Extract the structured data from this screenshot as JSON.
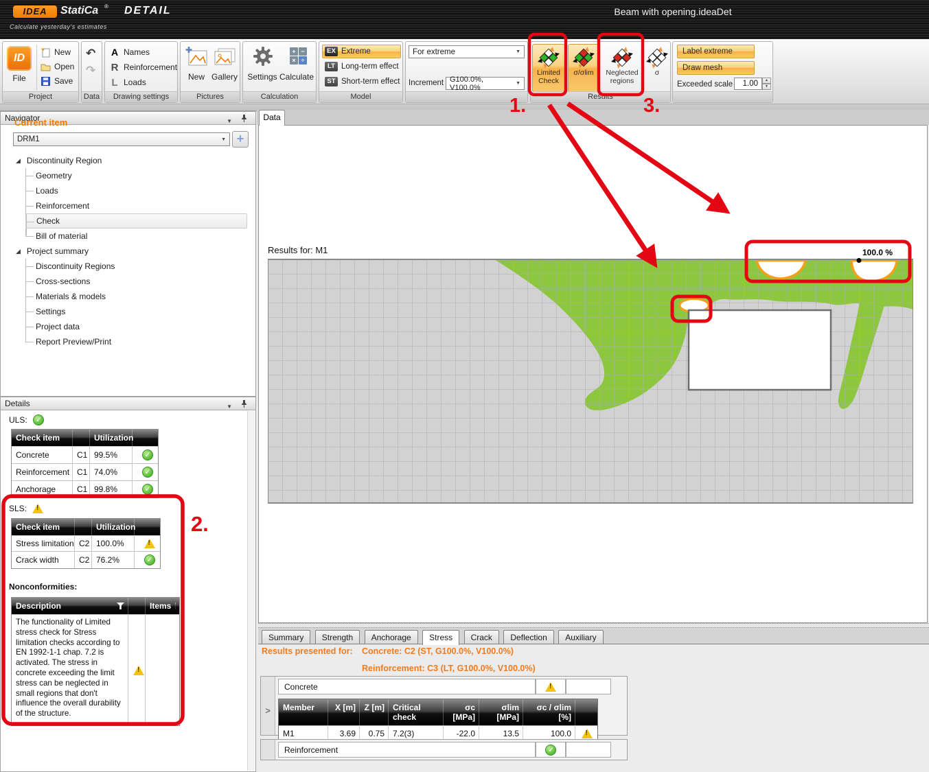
{
  "titlebar": {
    "brand_badge": "IDEA",
    "brand_name": "StatiCa",
    "brand_reg": "®",
    "product": "DETAIL",
    "tagline": "Calculate yesterday's estimates",
    "document": "Beam with opening.ideaDet"
  },
  "ribbon": {
    "project": {
      "label": "Project",
      "file": "File",
      "new": "New",
      "open": "Open",
      "save": "Save"
    },
    "data": {
      "label": "Data"
    },
    "drawing": {
      "label": "Drawing settings",
      "names": "Names",
      "reinforcement": "Reinforcement",
      "loads": "Loads"
    },
    "pictures": {
      "label": "Pictures",
      "new": "New",
      "gallery": "Gallery"
    },
    "calculation": {
      "label": "Calculation",
      "settings": "Settings",
      "calculate": "Calculate"
    },
    "model": {
      "label": "Model",
      "ex_badge": "EX",
      "ex": "Extreme",
      "lt_badge": "LT",
      "lt": "Long-term effect",
      "st_badge": "ST",
      "st": "Short-term effect",
      "for_extreme": "For extreme",
      "increment": "Increment",
      "increment_value": "G100.0%, V100.0%"
    },
    "results": {
      "label": "Results",
      "limited_check": "Limited Check",
      "sigma_slim": "σ/σlim",
      "neglected": "Neglected regions",
      "sigma": "σ",
      "label_extreme": "Label extreme",
      "draw_mesh": "Draw mesh",
      "exceeded_scale": "Exceeded scale",
      "exceeded_value": "1.00"
    }
  },
  "navigator": {
    "title": "Navigator",
    "current_item": "Current item",
    "current_value": "DRM1",
    "tree": [
      {
        "label": "Discontinuity Region"
      },
      {
        "label": "Geometry"
      },
      {
        "label": "Loads"
      },
      {
        "label": "Reinforcement"
      },
      {
        "label": "Check"
      },
      {
        "label": "Bill of material"
      },
      {
        "label": "Project summary"
      },
      {
        "label": "Discontinuity Regions"
      },
      {
        "label": "Cross-sections"
      },
      {
        "label": "Materials & models"
      },
      {
        "label": "Settings"
      },
      {
        "label": "Project data"
      },
      {
        "label": "Report Preview/Print"
      }
    ]
  },
  "details": {
    "title": "Details",
    "uls_label": "ULS:",
    "sls_label": "SLS:",
    "col_check_item": "Check item",
    "col_utilization": "Utilization",
    "uls_rows": [
      {
        "name": "Concrete",
        "cs": "C1",
        "util": "99.5%"
      },
      {
        "name": "Reinforcement",
        "cs": "C1",
        "util": "74.0%"
      },
      {
        "name": "Anchorage",
        "cs": "C1",
        "util": "99.8%"
      }
    ],
    "sls_rows": [
      {
        "name": "Stress limitation",
        "cs": "C2",
        "util": "100.0%"
      },
      {
        "name": "Crack width",
        "cs": "C2",
        "util": "76.2%"
      }
    ],
    "nonconformities_label": "Nonconformities:",
    "nc_col_description": "Description",
    "nc_col_items": "Items",
    "nc_text": "The functionality of Limited stress check for Stress limitation checks according to EN 1992-1-1 chap. 7.2 is activated. The stress in concrete exceeding the limit stress can be neglected in small regions that don't influence the overall durability of the structure."
  },
  "canvas": {
    "tab": "Data",
    "results_for": "Results for: M1",
    "extreme_label": "100.0 %"
  },
  "bottom": {
    "tabs": [
      "Summary",
      "Strength",
      "Anchorage",
      "Stress",
      "Crack",
      "Deflection",
      "Auxiliary"
    ],
    "active_tab": "Stress",
    "presented": "Results presented for:",
    "concrete_line": "Concrete: C2 (ST, G100.0%, V100.0%)",
    "reinforcement_line": "Reinforcement: C3 (LT, G100.0%, V100.0%)",
    "concrete": "Concrete",
    "reinforcement": "Reinforcement",
    "headers": [
      "Member",
      "X [m]",
      "Z [m]",
      "Critical check",
      "σc [MPa]",
      "σlim [MPa]",
      "σc / σlim [%]"
    ],
    "row": [
      "M1",
      "3.69",
      "0.75",
      "7.2(3)",
      "-22.0",
      "13.5",
      "100.0"
    ]
  },
  "annotations": {
    "n1": "1.",
    "n2": "2.",
    "n3": "3."
  },
  "colors": {
    "accent_orange": "#ef7b00",
    "green_ok": "#8dc63f",
    "exceed_orange": "#f5a01a",
    "annotation_red": "#e30613"
  }
}
